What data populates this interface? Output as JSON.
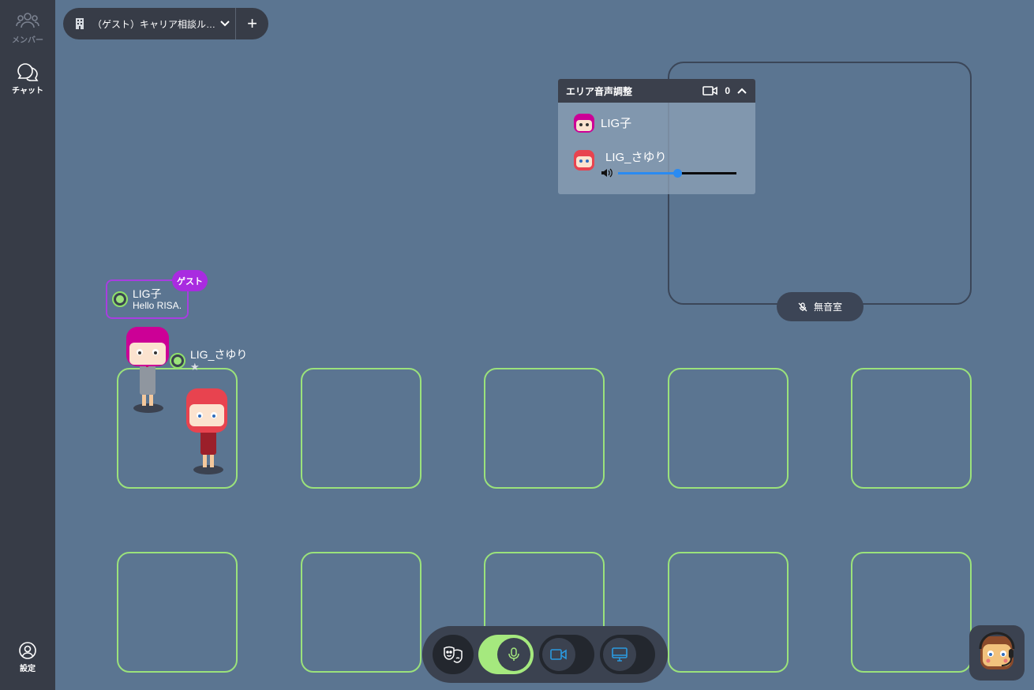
{
  "sidebar": {
    "members_label": "メンバー",
    "chat_label": "チャット",
    "settings_label": "設定"
  },
  "room": {
    "name": "（ゲスト）キャリア相談ル…",
    "add_label": "+"
  },
  "area_panel": {
    "title": "エリア音声調整",
    "video_count": "0",
    "users": [
      {
        "name": "LIG子"
      },
      {
        "name": "LIG_さゆり",
        "volume": 0.5
      }
    ]
  },
  "quiet_room": {
    "label": "無音室"
  },
  "users": {
    "ligko": {
      "name": "LIG子",
      "message": "Hello RISA.",
      "role_tag": "ゲスト"
    },
    "sayuri": {
      "name": "LIG_さゆり"
    }
  },
  "toolbar": {
    "mic_on": true,
    "camera_on": false,
    "screen_share_on": false
  },
  "colors": {
    "background": "#5b7591",
    "sidebar": "#373c47",
    "table_border": "#9be27b",
    "guest_tag": "#a92be0",
    "accent_blue": "#2a8bf2",
    "mic_active": "#a5e97e"
  }
}
